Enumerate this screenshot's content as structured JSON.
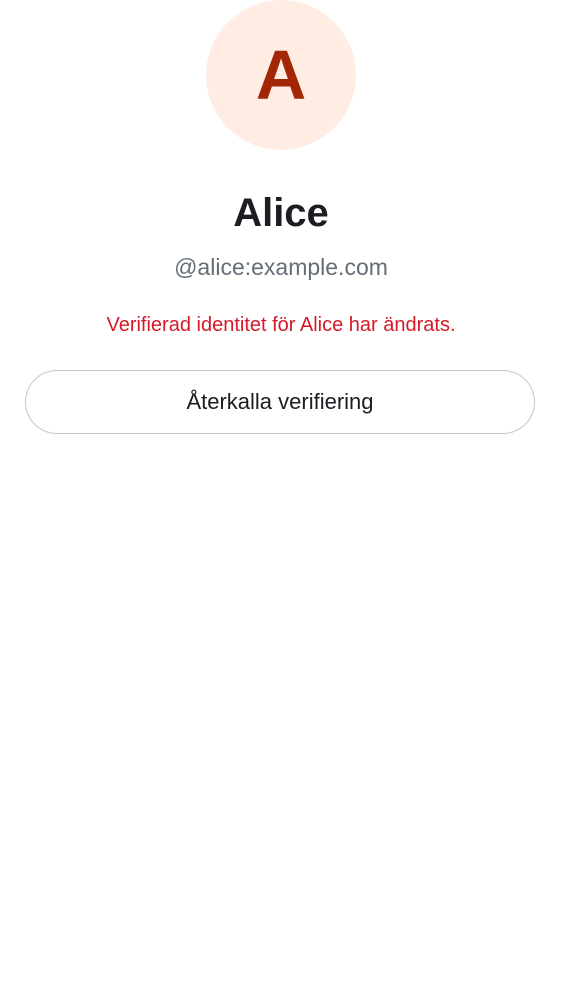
{
  "avatar": {
    "initial": "A",
    "background_color": "#ffede4",
    "text_color": "#a32607"
  },
  "profile": {
    "display_name": "Alice",
    "user_id": "@alice:example.com"
  },
  "warning": {
    "text": "Verifierad identitet för Alice har ändrats.",
    "color": "#d51928"
  },
  "actions": {
    "withdraw_verification_label": "Återkalla verifiering"
  }
}
